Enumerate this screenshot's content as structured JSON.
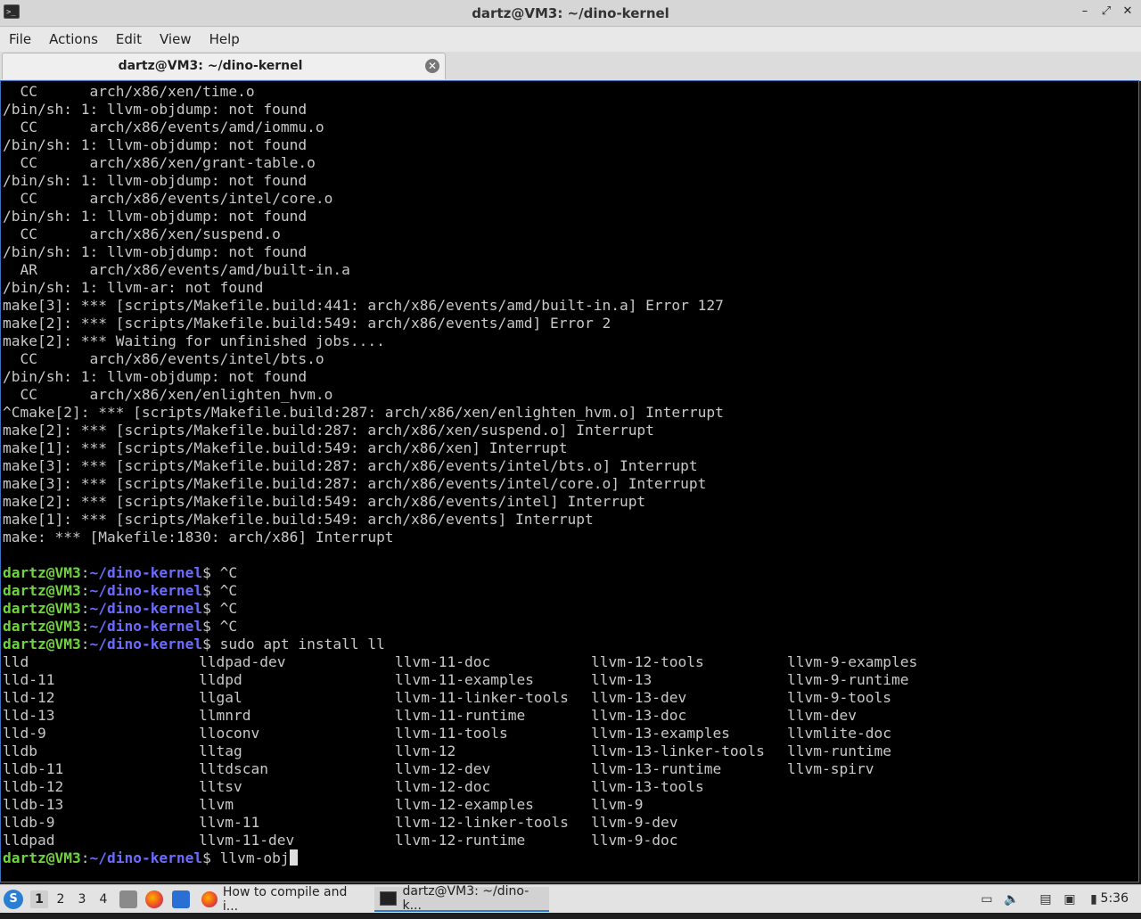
{
  "window": {
    "title": "dartz@VM3: ~/dino-kernel",
    "app_icon_glyph": ">_",
    "minimize_glyph": "–",
    "maximize_glyph": "⤢",
    "close_glyph": "✕"
  },
  "menu": [
    "File",
    "Actions",
    "Edit",
    "View",
    "Help"
  ],
  "tab": {
    "label": "dartz@VM3: ~/dino-kernel",
    "close_glyph": "✕"
  },
  "terminal": {
    "colors": {
      "user": "#6fd43b",
      "path": "#6b6bff",
      "text": "#c8c8c8"
    },
    "output_lines": [
      "  CC      arch/x86/xen/time.o",
      "/bin/sh: 1: llvm-objdump: not found",
      "  CC      arch/x86/events/amd/iommu.o",
      "/bin/sh: 1: llvm-objdump: not found",
      "  CC      arch/x86/xen/grant-table.o",
      "/bin/sh: 1: llvm-objdump: not found",
      "  CC      arch/x86/events/intel/core.o",
      "/bin/sh: 1: llvm-objdump: not found",
      "  CC      arch/x86/xen/suspend.o",
      "/bin/sh: 1: llvm-objdump: not found",
      "  AR      arch/x86/events/amd/built-in.a",
      "/bin/sh: 1: llvm-ar: not found",
      "make[3]: *** [scripts/Makefile.build:441: arch/x86/events/amd/built-in.a] Error 127",
      "make[2]: *** [scripts/Makefile.build:549: arch/x86/events/amd] Error 2",
      "make[2]: *** Waiting for unfinished jobs....",
      "  CC      arch/x86/events/intel/bts.o",
      "/bin/sh: 1: llvm-objdump: not found",
      "  CC      arch/x86/xen/enlighten_hvm.o",
      "^Cmake[2]: *** [scripts/Makefile.build:287: arch/x86/xen/enlighten_hvm.o] Interrupt",
      "make[2]: *** [scripts/Makefile.build:287: arch/x86/xen/suspend.o] Interrupt",
      "make[1]: *** [scripts/Makefile.build:549: arch/x86/xen] Interrupt",
      "make[3]: *** [scripts/Makefile.build:287: arch/x86/events/intel/bts.o] Interrupt",
      "make[3]: *** [scripts/Makefile.build:287: arch/x86/events/intel/core.o] Interrupt",
      "make[2]: *** [scripts/Makefile.build:549: arch/x86/events/intel] Interrupt",
      "make[1]: *** [scripts/Makefile.build:549: arch/x86/events] Interrupt",
      "make: *** [Makefile:1830: arch/x86] Interrupt",
      ""
    ],
    "prompt": {
      "user": "dartz@VM3",
      "sep": ":",
      "path": "~/dino-kernel",
      "sym": "$ "
    },
    "commands": [
      "^C",
      "^C",
      "^C",
      "^C",
      "sudo apt install ll"
    ],
    "completion_columns": [
      [
        "lld",
        "lld-11",
        "lld-12",
        "lld-13",
        "lld-9",
        "lldb",
        "lldb-11",
        "lldb-12",
        "lldb-13",
        "lldb-9",
        "lldpad"
      ],
      [
        "lldpad-dev",
        "lldpd",
        "llgal",
        "llmnrd",
        "lloconv",
        "lltag",
        "lltdscan",
        "lltsv",
        "llvm",
        "llvm-11",
        "llvm-11-dev"
      ],
      [
        "llvm-11-doc",
        "llvm-11-examples",
        "llvm-11-linker-tools",
        "llvm-11-runtime",
        "llvm-11-tools",
        "llvm-12",
        "llvm-12-dev",
        "llvm-12-doc",
        "llvm-12-examples",
        "llvm-12-linker-tools",
        "llvm-12-runtime"
      ],
      [
        "llvm-12-tools",
        "llvm-13",
        "llvm-13-dev",
        "llvm-13-doc",
        "llvm-13-examples",
        "llvm-13-linker-tools",
        "llvm-13-runtime",
        "llvm-13-tools",
        "llvm-9",
        "llvm-9-dev",
        "llvm-9-doc"
      ],
      [
        "llvm-9-examples",
        "llvm-9-runtime",
        "llvm-9-tools",
        "llvm-dev",
        "llvmlite-doc",
        "llvm-runtime",
        "llvm-spirv"
      ]
    ],
    "current_input": "llvm-obj"
  },
  "taskbar": {
    "menu_glyph": "S",
    "workspaces": [
      "1",
      "2",
      "3",
      "4"
    ],
    "tasks": [
      {
        "label": "How to compile and i...",
        "icon": "firefox-icon"
      },
      {
        "label": "dartz@VM3: ~/dino-k...",
        "icon": "terminal-icon"
      }
    ],
    "tray_glyphs": {
      "disk": "▭",
      "volume": "🔈",
      "clipboard": "▤",
      "monitor": "▣",
      "battery": "▮"
    },
    "clock": "5:36"
  }
}
